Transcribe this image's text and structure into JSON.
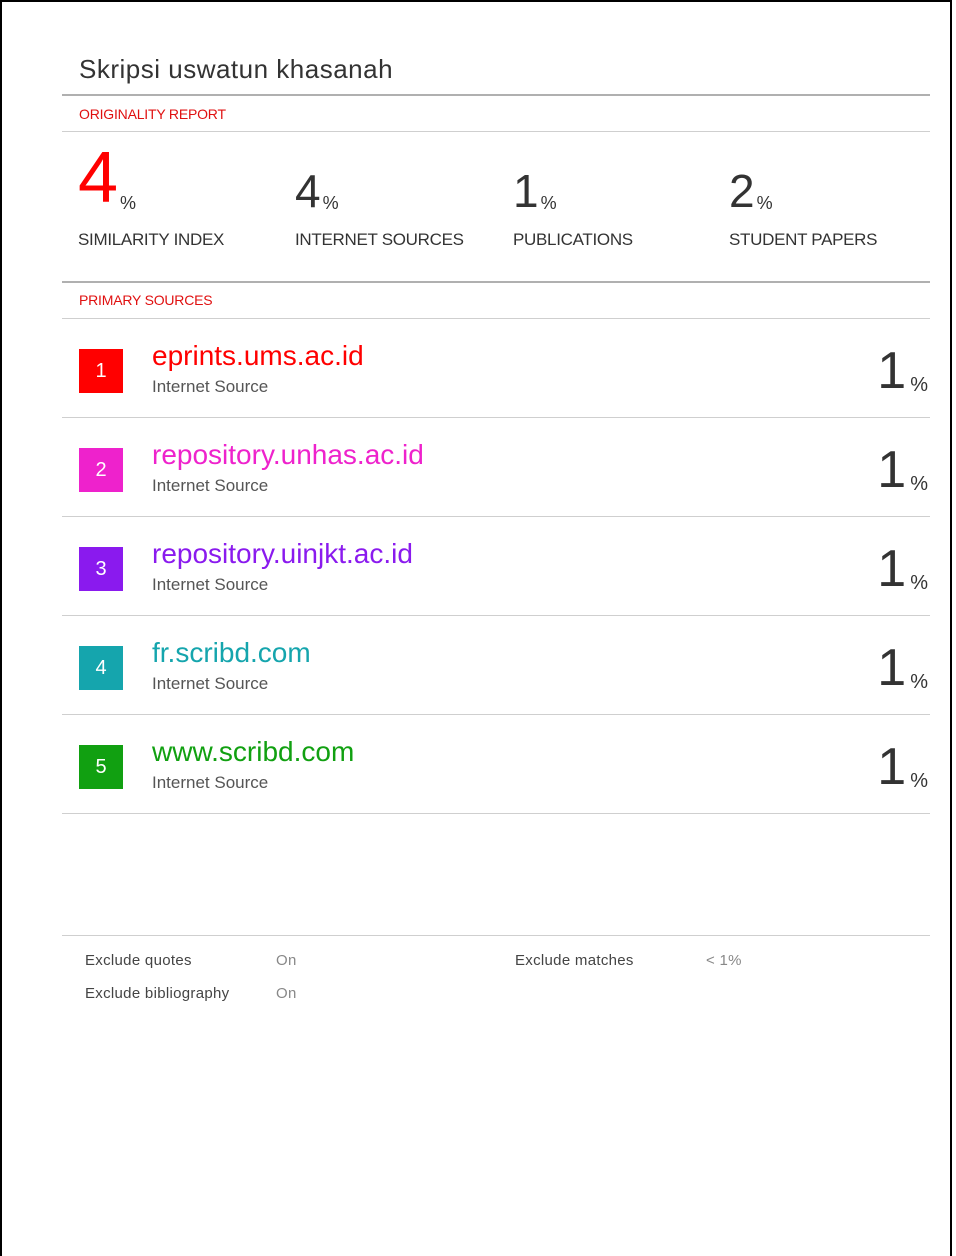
{
  "report": {
    "title": "Skripsi uswatun khasanah",
    "originality_label": "ORIGINALITY REPORT",
    "primary_sources_label": "PRIMARY SOURCES"
  },
  "stats": [
    {
      "value": "4",
      "unit": "%",
      "label": "SIMILARITY INDEX"
    },
    {
      "value": "4",
      "unit": "%",
      "label": "INTERNET SOURCES"
    },
    {
      "value": "1",
      "unit": "%",
      "label": "PUBLICATIONS"
    },
    {
      "value": "2",
      "unit": "%",
      "label": "STUDENT PAPERS"
    }
  ],
  "sources": [
    {
      "rank": "1",
      "name": "eprints.ums.ac.id",
      "type": "Internet Source",
      "percent": "1",
      "unit": "%",
      "color": "#ff0000"
    },
    {
      "rank": "2",
      "name": "repository.unhas.ac.id",
      "type": "Internet Source",
      "percent": "1",
      "unit": "%",
      "color": "#ee22cc"
    },
    {
      "rank": "3",
      "name": "repository.uinjkt.ac.id",
      "type": "Internet Source",
      "percent": "1",
      "unit": "%",
      "color": "#8a1aee"
    },
    {
      "rank": "4",
      "name": "fr.scribd.com",
      "type": "Internet Source",
      "percent": "1",
      "unit": "%",
      "color": "#15a5ad"
    },
    {
      "rank": "5",
      "name": "www.scribd.com",
      "type": "Internet Source",
      "percent": "1",
      "unit": "%",
      "color": "#11a011"
    }
  ],
  "settings": {
    "exclude_quotes_label": "Exclude quotes",
    "exclude_quotes_value": "On",
    "exclude_bibliography_label": "Exclude bibliography",
    "exclude_bibliography_value": "On",
    "exclude_matches_label": "Exclude matches",
    "exclude_matches_value": "< 1%"
  }
}
